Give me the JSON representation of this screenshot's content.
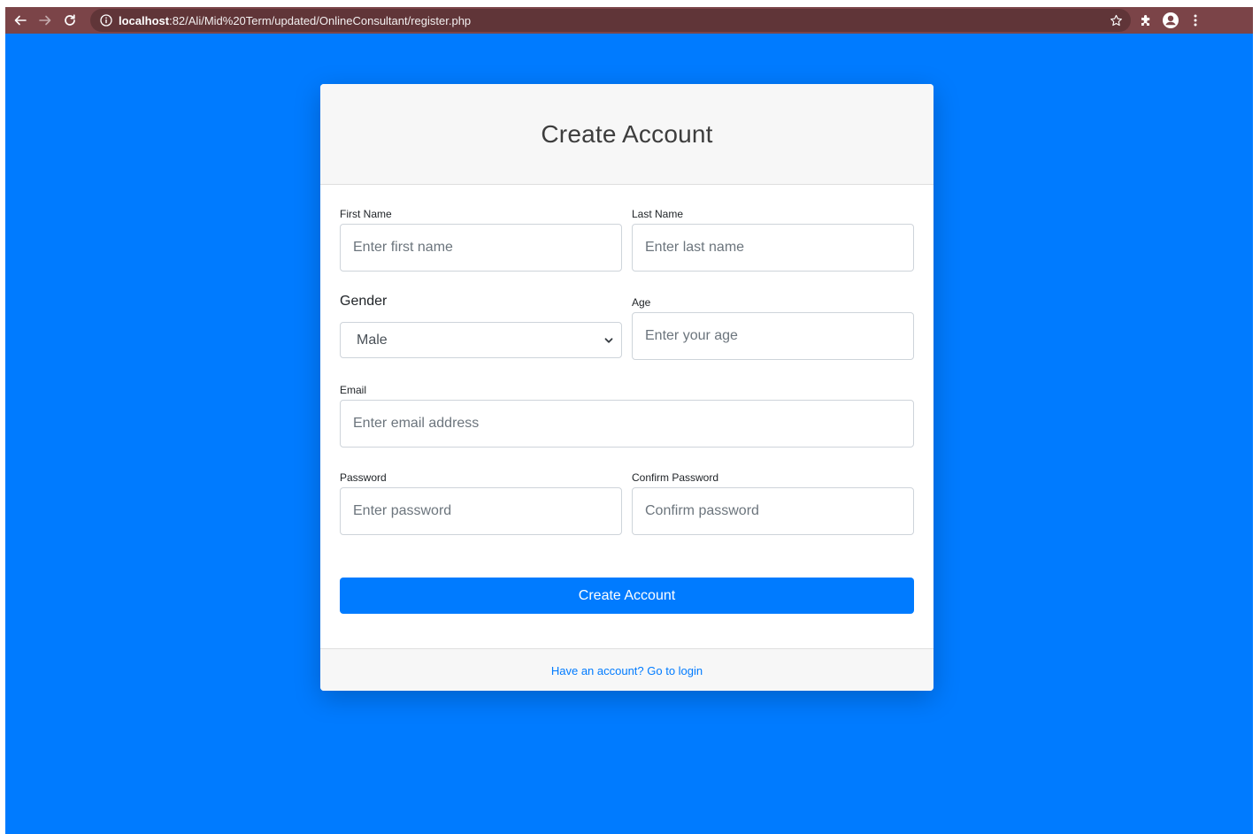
{
  "browser": {
    "url_host": "localhost",
    "url_rest": ":82/Ali/Mid%20Term/updated/OnlineConsultant/register.php"
  },
  "colors": {
    "page_background": "#007bff",
    "toolbar": "#7b4448",
    "primary": "#007bff"
  },
  "card": {
    "title": "Create Account",
    "fields": {
      "first_name": {
        "label": "First Name",
        "placeholder": "Enter first name"
      },
      "last_name": {
        "label": "Last Name",
        "placeholder": "Enter last name"
      },
      "gender": {
        "label": "Gender",
        "selected": "Male"
      },
      "age": {
        "label": "Age",
        "placeholder": "Enter your age"
      },
      "email": {
        "label": "Email",
        "placeholder": "Enter email address"
      },
      "password": {
        "label": "Password",
        "placeholder": "Enter password"
      },
      "confirm_password": {
        "label": "Confirm Password",
        "placeholder": "Confirm password"
      }
    },
    "submit_label": "Create Account",
    "footer_link": "Have an account? Go to login"
  }
}
